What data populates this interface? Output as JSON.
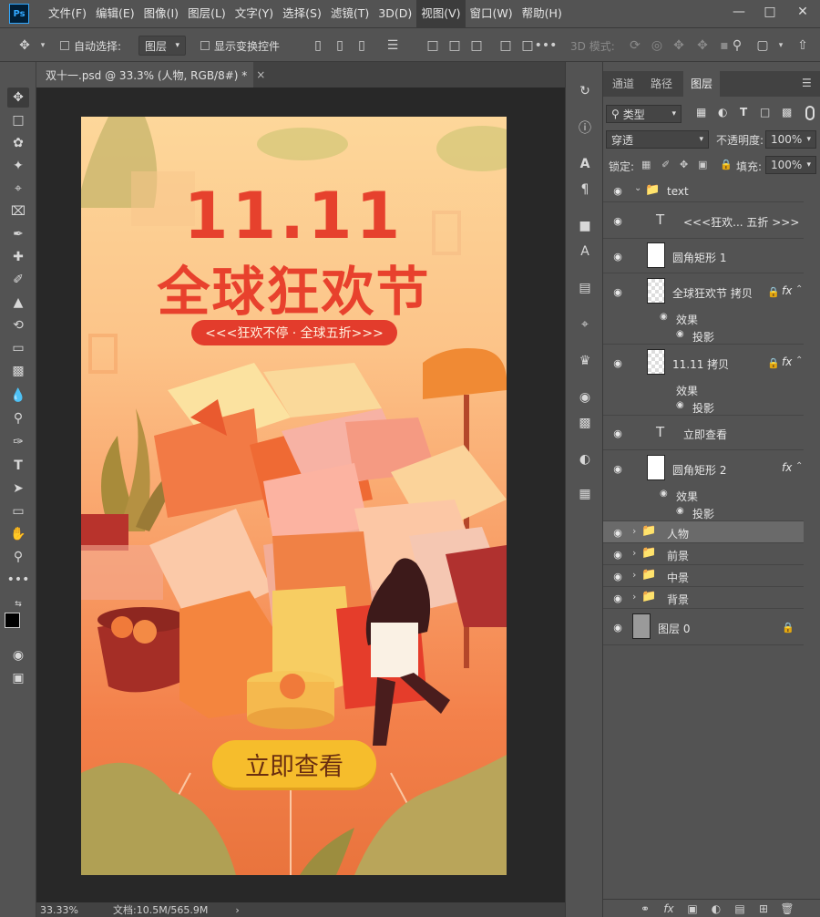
{
  "menubar": {
    "logo": "Ps",
    "items": [
      "文件(F)",
      "编辑(E)",
      "图像(I)",
      "图层(L)",
      "文字(Y)",
      "选择(S)",
      "滤镜(T)",
      "3D(D)",
      "视图(V)",
      "窗口(W)",
      "帮助(H)"
    ],
    "active_item": "视图(V)"
  },
  "options_bar": {
    "auto_select_label": "自动选择:",
    "auto_select_target": "图层",
    "show_transform_label": "显示变换控件",
    "mode_3d_label": "3D 模式:"
  },
  "document": {
    "tab_title": "双十一.psd @ 33.3% (人物, RGB/8#) *",
    "zoom": "33.33%",
    "doc_size": "文档:10.5M/565.9M"
  },
  "poster": {
    "title": "11.11",
    "subtitle": "全球狂欢节",
    "tagline": "<<<狂欢不停 · 全球五折>>>",
    "cta": "立即查看",
    "colors": {
      "title": "#e6412d",
      "tag_bg": "#e33c2c",
      "cta_bg": "#f6bd2c"
    }
  },
  "layers_panel": {
    "tabs": [
      "通道",
      "路径",
      "图层"
    ],
    "active_tab": "图层",
    "filter_kind": "类型",
    "blend_mode": "穿透",
    "opacity_label": "不透明度:",
    "opacity_value": "100%",
    "lock_label": "锁定:",
    "fill_label": "填充:",
    "fill_value": "100%",
    "layers": [
      {
        "name": "text",
        "type": "group",
        "expanded": true
      },
      {
        "name": "<<<狂欢... 五折 >>>",
        "type": "text"
      },
      {
        "name": "圆角矩形 1",
        "type": "shape"
      },
      {
        "name": "全球狂欢节 拷贝",
        "type": "pixel",
        "locked": true,
        "fx": true
      },
      {
        "name": "效果",
        "type": "effect-group"
      },
      {
        "name": "投影",
        "type": "effect"
      },
      {
        "name": "11.11 拷贝",
        "type": "pixel",
        "locked": true,
        "fx": true
      },
      {
        "name": "效果",
        "type": "effect-group"
      },
      {
        "name": "投影",
        "type": "effect"
      },
      {
        "name": "立即查看",
        "type": "text"
      },
      {
        "name": "圆角矩形 2",
        "type": "shape",
        "fx": true
      },
      {
        "name": "效果",
        "type": "effect-group"
      },
      {
        "name": "投影",
        "type": "effect"
      },
      {
        "name": "人物",
        "type": "group",
        "selected": true
      },
      {
        "name": "前景",
        "type": "group"
      },
      {
        "name": "中景",
        "type": "group"
      },
      {
        "name": "背景",
        "type": "group"
      },
      {
        "name": "图层 0",
        "type": "pixel",
        "locked": true
      }
    ]
  },
  "icons": {
    "tools": [
      "move-tool-icon",
      "marquee-icon",
      "lasso-icon",
      "magic-wand-icon",
      "crop-icon",
      "frame-icon",
      "eyedropper-icon",
      "healing-brush-icon",
      "brush-icon",
      "clone-stamp-icon",
      "history-brush-icon",
      "eraser-icon",
      "gradient-icon",
      "blur-icon",
      "dodge-icon",
      "pen-icon",
      "type-icon",
      "path-select-icon",
      "rectangle-icon",
      "hand-icon",
      "zoom-icon",
      "more-icon"
    ],
    "panel_bottom": [
      "link-icon",
      "fx-icon",
      "mask-icon",
      "adjustment-icon",
      "folder-icon",
      "new-layer-icon",
      "delete-icon"
    ]
  }
}
